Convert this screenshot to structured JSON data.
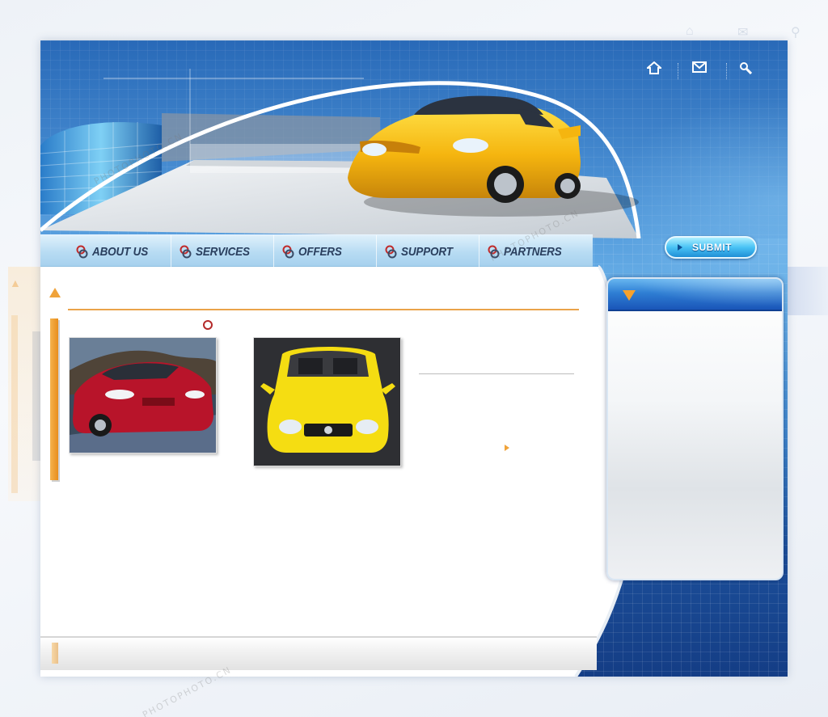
{
  "header": {
    "icons": [
      {
        "name": "home-icon"
      },
      {
        "name": "mail-icon"
      },
      {
        "name": "search-icon"
      }
    ]
  },
  "nav": {
    "items": [
      {
        "label": "ABOUT US"
      },
      {
        "label": "SERVICES"
      },
      {
        "label": "OFFERS"
      },
      {
        "label": "SUPPORT"
      },
      {
        "label": "PARTNERS"
      }
    ]
  },
  "submit": {
    "label": "SUBMIT"
  },
  "gallery": [
    {
      "name": "red-sedan-photo",
      "color": "#b8142a"
    },
    {
      "name": "yellow-convertible-photo",
      "color": "#f5dd12"
    }
  ],
  "colors": {
    "accent": "#f0a33a",
    "brand_blue": "#1a55b8",
    "light_blue": "#b8dcf3"
  },
  "watermarks": [
    "PHOTOPHOTO.CN",
    "PHOTOPHOTO.CN",
    "PHOTOPHOTO.CN"
  ]
}
